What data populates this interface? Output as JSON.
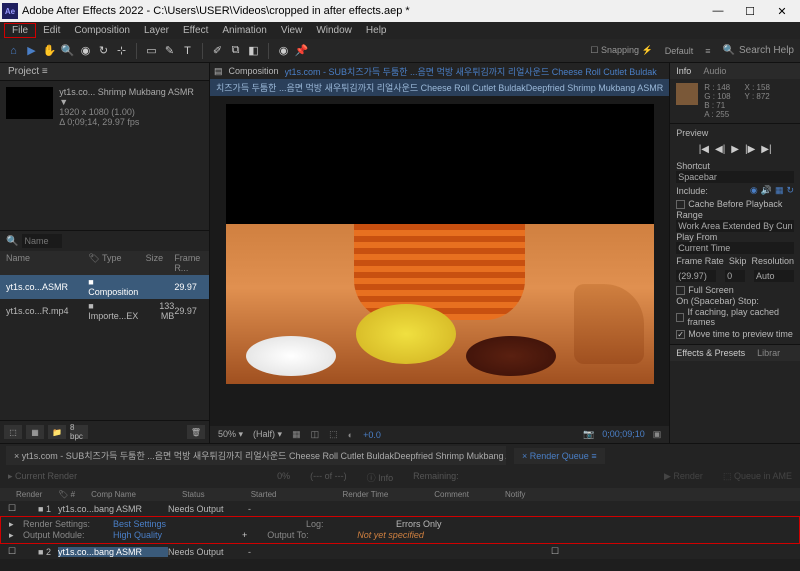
{
  "titlebar": {
    "app": "Adobe After Effects 2022",
    "path": "C:\\Users\\USER\\Videos\\cropped in after effects.aep *"
  },
  "menu": [
    "File",
    "Edit",
    "Composition",
    "Layer",
    "Effect",
    "Animation",
    "View",
    "Window",
    "Help"
  ],
  "toolbar": {
    "snapping": "Snapping",
    "default": "Default",
    "search": "Search Help"
  },
  "project": {
    "tab": "Project",
    "selected_name": "yt1s.co... Shrimp Mukbang ASMR ▼",
    "selected_res": "1920 x 1080 (1.00)",
    "selected_dur": "Δ 0;09;14, 29.97 fps",
    "search_placeholder": "Name",
    "headers": {
      "name": "Name",
      "type": "Type",
      "size": "Size",
      "frame": "Frame R..."
    },
    "rows": [
      {
        "name": "yt1s.co...ASMR",
        "type": "Composition",
        "size": "",
        "frame": "29.97"
      },
      {
        "name": "yt1s.co...R.mp4",
        "type": "Importe...EX",
        "size": "133 MB",
        "frame": "29.97"
      }
    ],
    "bpc": "8 bpc"
  },
  "composition": {
    "label": "Composition",
    "tab1": "yt1s.com - SUB치즈가득 두툼한 ...음면 먹방 새우튀김까지 리얼사운드 Cheese Roll Cutlet Buldak",
    "breadcrumb": "치즈가득 두툼한 ...음면 먹방 새우튀김까지 리얼사운드 Cheese Roll Cutlet BuldakDeepfried Shrimp Mukbang ASMR"
  },
  "viewer": {
    "zoom": "50%",
    "quality": "(Half)",
    "exposure": "+0.0",
    "time": "0;00;09;10"
  },
  "rightpanel": {
    "tab_info": "Info",
    "tab_audio": "Audio",
    "r": "R :  148",
    "g": "G :  108",
    "b": "B :  71",
    "a": "A :  255",
    "x": "X :  158",
    "y": "Y :  872",
    "preview_label": "Preview",
    "shortcut_label": "Shortcut",
    "shortcut": "Spacebar",
    "include_label": "Include:",
    "cache_before": "Cache Before Playback",
    "range_label": "Range",
    "range": "Work Area Extended By Current...",
    "playfrom_label": "Play From",
    "playfrom": "Current Time",
    "framerate_label": "Frame Rate",
    "skip_label": "Skip",
    "res_label": "Resolution",
    "framerate": "(29.97)",
    "skip": "0",
    "res": "Auto",
    "fullscreen": "Full Screen",
    "spacebar_stop": "On (Spacebar) Stop:",
    "if_caching": "If caching, play cached frames",
    "move_time": "Move time to preview time",
    "effects_label": "Effects & Presets",
    "libraries": "Librar"
  },
  "timeline": {
    "comp_tab": "yt1s.com - SUB치즈가득 두툼한 ...음면 먹방 새우튀김까지 리얼사운드 Cheese Roll Cutlet BuldakDeepfried Shrimp Mukbang ASMR",
    "render_queue": "Render Queue",
    "current_render": "Current Render",
    "pct": "0%",
    "of": "(--- of ---)",
    "info": "Info",
    "remaining": "Remaining:",
    "render_btn": "Render",
    "queue_ame": "Queue in AME",
    "headers": {
      "render": "Render",
      "num": "#",
      "comp": "Comp Name",
      "status": "Status",
      "started": "Started",
      "rtime": "Render Time",
      "comment": "Comment",
      "notify": "Notify"
    },
    "row1": {
      "num": "1",
      "comp": "yt1s.co...bang ASMR",
      "status": "Needs Output",
      "started": "-"
    },
    "render_settings_label": "Render Settings:",
    "render_settings_val": "Best Settings",
    "log_label": "Log:",
    "log_val": "Errors Only",
    "output_module_label": "Output Module:",
    "output_module_val": "High Quality",
    "output_to_label": "Output To:",
    "output_to_val": "Not yet specified",
    "row2": {
      "num": "2",
      "comp": "yt1s.co...bang ASMR",
      "status": "Needs Output",
      "started": "-"
    }
  }
}
